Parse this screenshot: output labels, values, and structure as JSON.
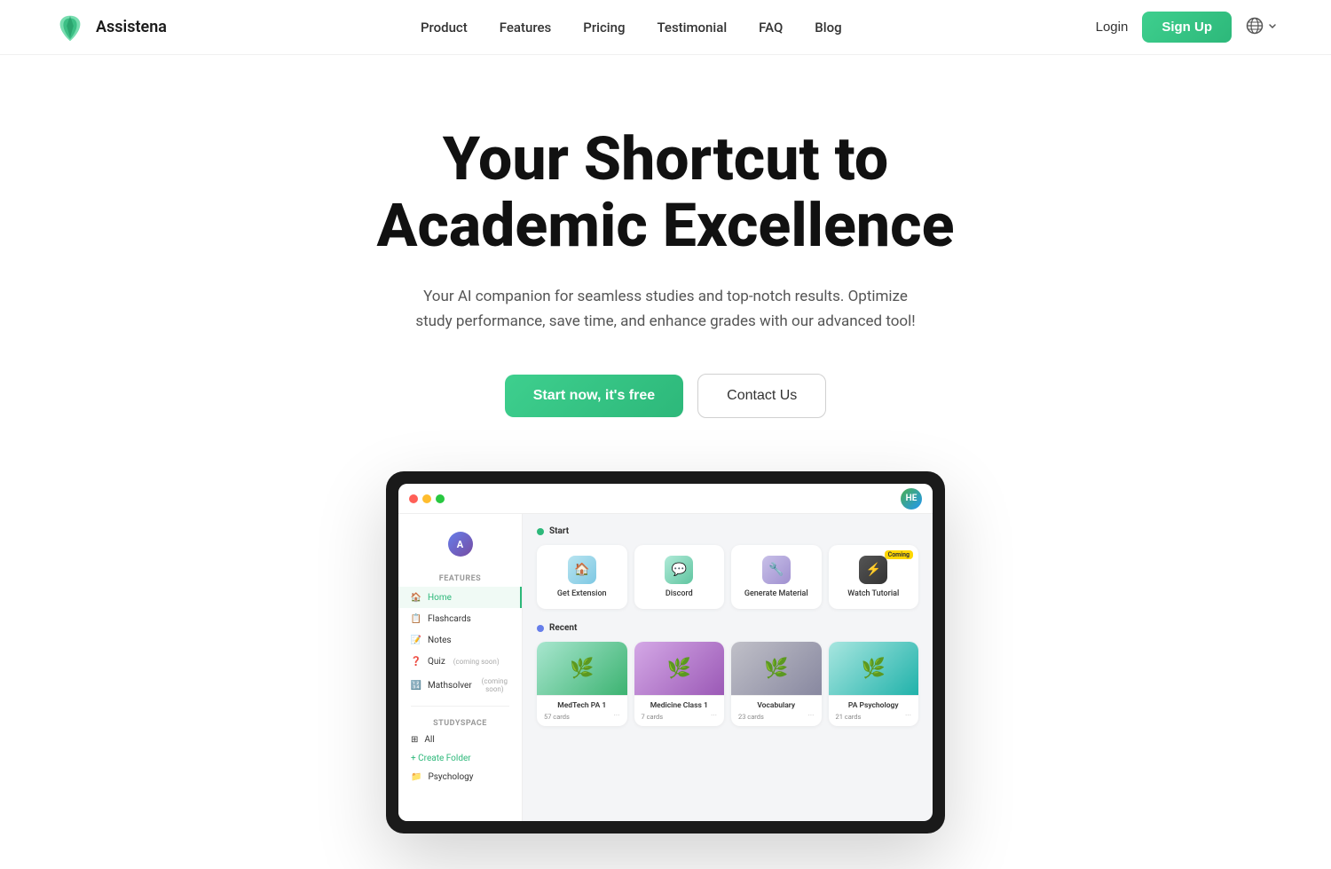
{
  "brand": {
    "name": "Assistena",
    "logo_alt": "Assistena logo"
  },
  "nav": {
    "links": [
      {
        "id": "product",
        "label": "Product"
      },
      {
        "id": "features",
        "label": "Features"
      },
      {
        "id": "pricing",
        "label": "Pricing"
      },
      {
        "id": "testimonial",
        "label": "Testimonial"
      },
      {
        "id": "faq",
        "label": "FAQ"
      },
      {
        "id": "blog",
        "label": "Blog"
      }
    ],
    "login_label": "Login",
    "signup_label": "Sign Up",
    "lang": "🌐"
  },
  "hero": {
    "title_line1": "Your Shortcut to",
    "title_line2": "Academic Excellence",
    "subtitle": "Your AI companion for seamless studies and top-notch results. Optimize study performance, save time, and enhance grades with our advanced tool!",
    "cta_primary": "Start now, it's free",
    "cta_secondary": "Contact Us"
  },
  "app_preview": {
    "user_avatar": "HE",
    "sidebar": {
      "features_label": "Features",
      "items": [
        {
          "label": "Home",
          "active": true,
          "coming": ""
        },
        {
          "label": "Flashcards",
          "active": false,
          "coming": ""
        },
        {
          "label": "Notes",
          "active": false,
          "coming": ""
        },
        {
          "label": "Quiz",
          "active": false,
          "coming": "(coming soon)"
        },
        {
          "label": "Mathsolver",
          "active": false,
          "coming": "(coming soon)"
        }
      ],
      "studyspace_label": "Studyspace",
      "folder_label": "All",
      "create_label": "+ Create Folder",
      "bottom_label": "Psychology"
    },
    "quick_start": {
      "section_label": "Start",
      "cards": [
        {
          "label": "Get Extension",
          "icon": "🏠",
          "color": "qc-blue",
          "coming": false
        },
        {
          "label": "Discord",
          "icon": "💬",
          "color": "qc-teal",
          "coming": false
        },
        {
          "label": "Generate Material",
          "icon": "🔧",
          "color": "qc-purple",
          "coming": false
        },
        {
          "label": "Watch Tutorial",
          "icon": "⚡",
          "color": "qc-dark",
          "coming": true
        }
      ]
    },
    "recent": {
      "section_label": "Recent",
      "cards": [
        {
          "title": "MedTech PA 1",
          "cards_count": "57 cards",
          "color": "rc-green",
          "icon": "🌿"
        },
        {
          "title": "Medicine Class 1",
          "cards_count": "7 cards",
          "color": "rc-purple",
          "icon": "🌿"
        },
        {
          "title": "Vocabulary",
          "cards_count": "23 cards",
          "color": "rc-gray",
          "icon": "🌿"
        },
        {
          "title": "PA Psychology",
          "cards_count": "21 cards",
          "color": "rc-teal",
          "icon": "🌿"
        }
      ]
    }
  }
}
